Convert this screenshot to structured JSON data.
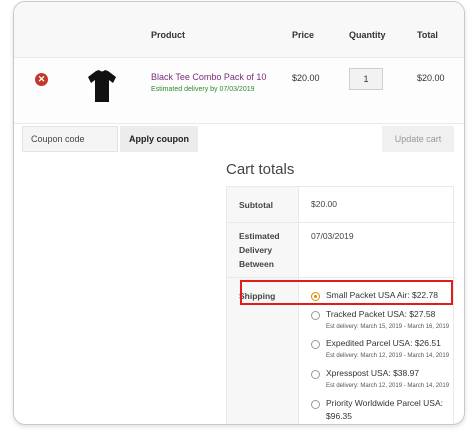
{
  "table": {
    "headers": {
      "product": "Product",
      "price": "Price",
      "quantity": "Quantity",
      "total": "Total"
    },
    "item": {
      "remove_glyph": "✕",
      "name": "Black Tee Combo Pack of 10",
      "delivery": "Estimated delivery by 07/03/2019",
      "price": "$20.00",
      "quantity": "1",
      "total": "$20.00"
    }
  },
  "coupon": {
    "placeholder": "Coupon code",
    "apply_label": "Apply coupon",
    "update_label": "Update cart"
  },
  "cart_totals": {
    "title": "Cart totals",
    "subtotal_label": "Subtotal",
    "subtotal_value": "$20.00",
    "delivery_label": "Estimated Delivery Between",
    "delivery_label_lines": [
      "Estimated",
      "Delivery",
      "Between"
    ],
    "delivery_value": "07/03/2019",
    "shipping_label": "Shipping",
    "shipping_options": [
      {
        "label": "Small Packet USA Air: $22.78",
        "selected": true,
        "est": ""
      },
      {
        "label": "Tracked Packet USA: $27.58",
        "selected": false,
        "est": "Est delivery: March 15, 2019 - March 16, 2019"
      },
      {
        "label": "Expedited Parcel USA: $26.51",
        "selected": false,
        "est": "Est delivery: March 12, 2019 - March 14, 2019"
      },
      {
        "label": "Xpresspost USA: $38.97",
        "selected": false,
        "est": "Est delivery: March 12, 2019 - March 14, 2019"
      },
      {
        "label": "Priority Worldwide Parcel USA:",
        "continuation": "$96.35",
        "selected": false,
        "est": ""
      }
    ]
  },
  "colors": {
    "highlight_border": "#e21b1b",
    "product_link": "#7b2d7b",
    "delivery_text": "#2e8b2e",
    "remove_icon": "#c0392b",
    "radio_selected": "#e08a00"
  }
}
